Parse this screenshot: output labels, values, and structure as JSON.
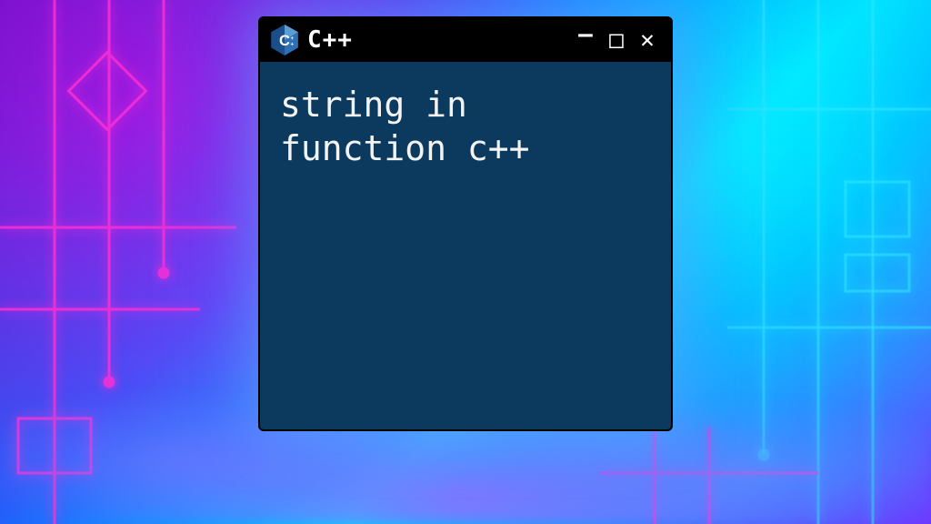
{
  "window": {
    "title": "C++",
    "icon": "cpp-logo",
    "controls": {
      "minimize": "–",
      "maximize": "□",
      "close": "✕"
    }
  },
  "content": {
    "text": "string in\nfunction c++"
  },
  "colors": {
    "window_bg": "#0b3a5e",
    "titlebar_bg": "#000000",
    "text": "#f3f3f3",
    "neon_pink": "#ff2fd6",
    "neon_cyan": "#2fe8ff"
  }
}
